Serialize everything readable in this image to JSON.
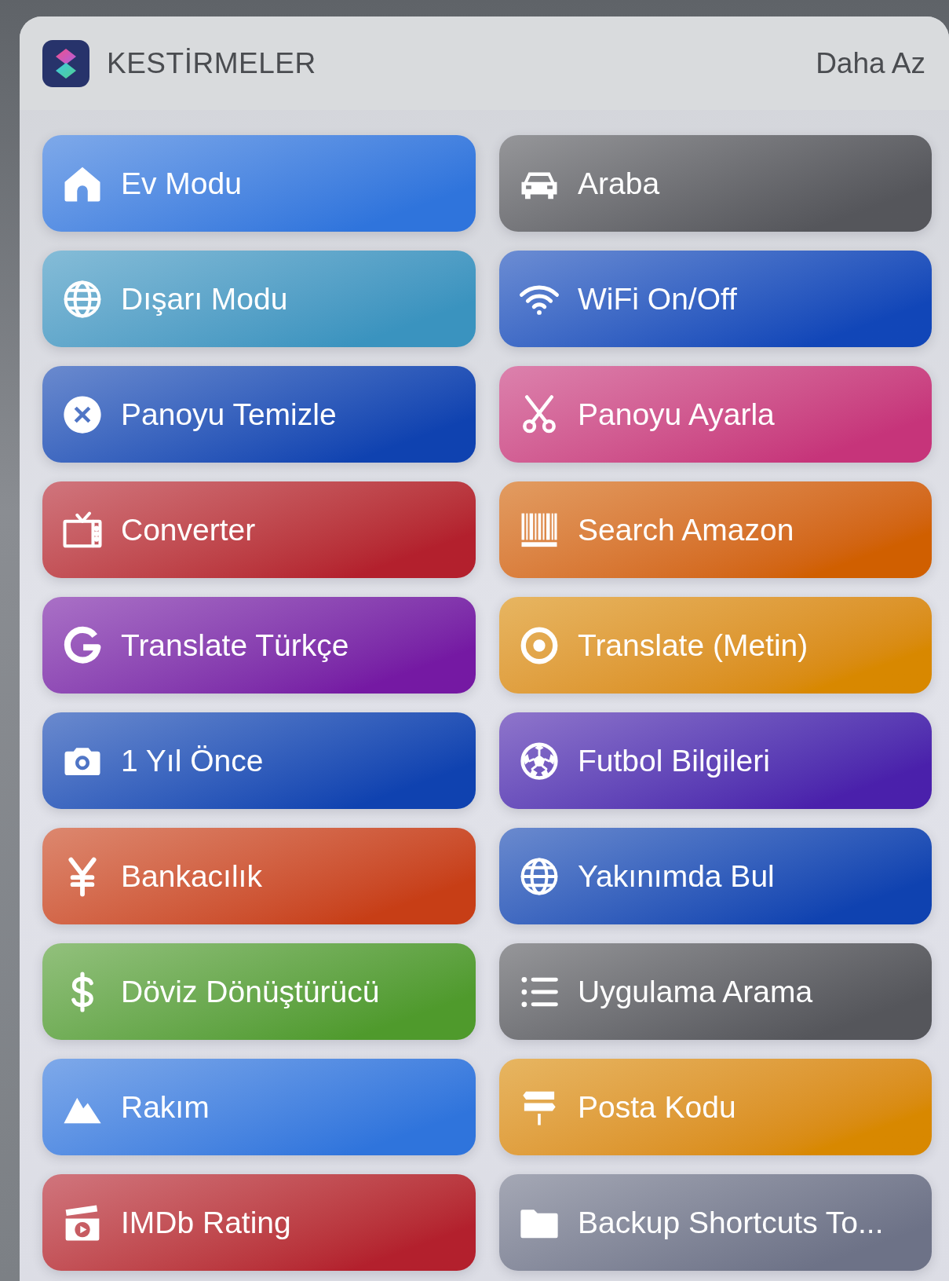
{
  "widget": {
    "title": "KESTİRMELER",
    "toggle": "Daha Az"
  },
  "shortcuts": [
    {
      "label": "Ev Modu",
      "color": "#2f74dc"
    },
    {
      "label": "Araba",
      "color": "#55565b"
    },
    {
      "label": "Dışarı Modu",
      "color": "#3a93bf"
    },
    {
      "label": "WiFi On/Off",
      "color": "#1146b8"
    },
    {
      "label": "Panoyu Temizle",
      "color": "#0f42b0"
    },
    {
      "label": "Panoyu Ayarla",
      "color": "#c6347a"
    },
    {
      "label": "Converter",
      "color": "#b3202d"
    },
    {
      "label": "Search Amazon",
      "color": "#d05f00"
    },
    {
      "label": "Translate Türkçe",
      "color": "#7519a3"
    },
    {
      "label": "Translate (Metin)",
      "color": "#d88800"
    },
    {
      "label": "1 Yıl Önce",
      "color": "#0f42b0"
    },
    {
      "label": "Futbol Bilgileri",
      "color": "#4a20ab"
    },
    {
      "label": "Bankacılık",
      "color": "#c73e16"
    },
    {
      "label": "Yakınımda Bul",
      "color": "#0f42b0"
    },
    {
      "label": "Döviz Dönüştürücü",
      "color": "#4f9a2c"
    },
    {
      "label": "Uygulama Arama",
      "color": "#55565b"
    },
    {
      "label": "Rakım",
      "color": "#2f74dc"
    },
    {
      "label": "Posta Kodu",
      "color": "#d88800"
    },
    {
      "label": "IMDb Rating",
      "color": "#b3202d"
    },
    {
      "label": "Backup Shortcuts To...",
      "color": "#6d7287"
    }
  ]
}
